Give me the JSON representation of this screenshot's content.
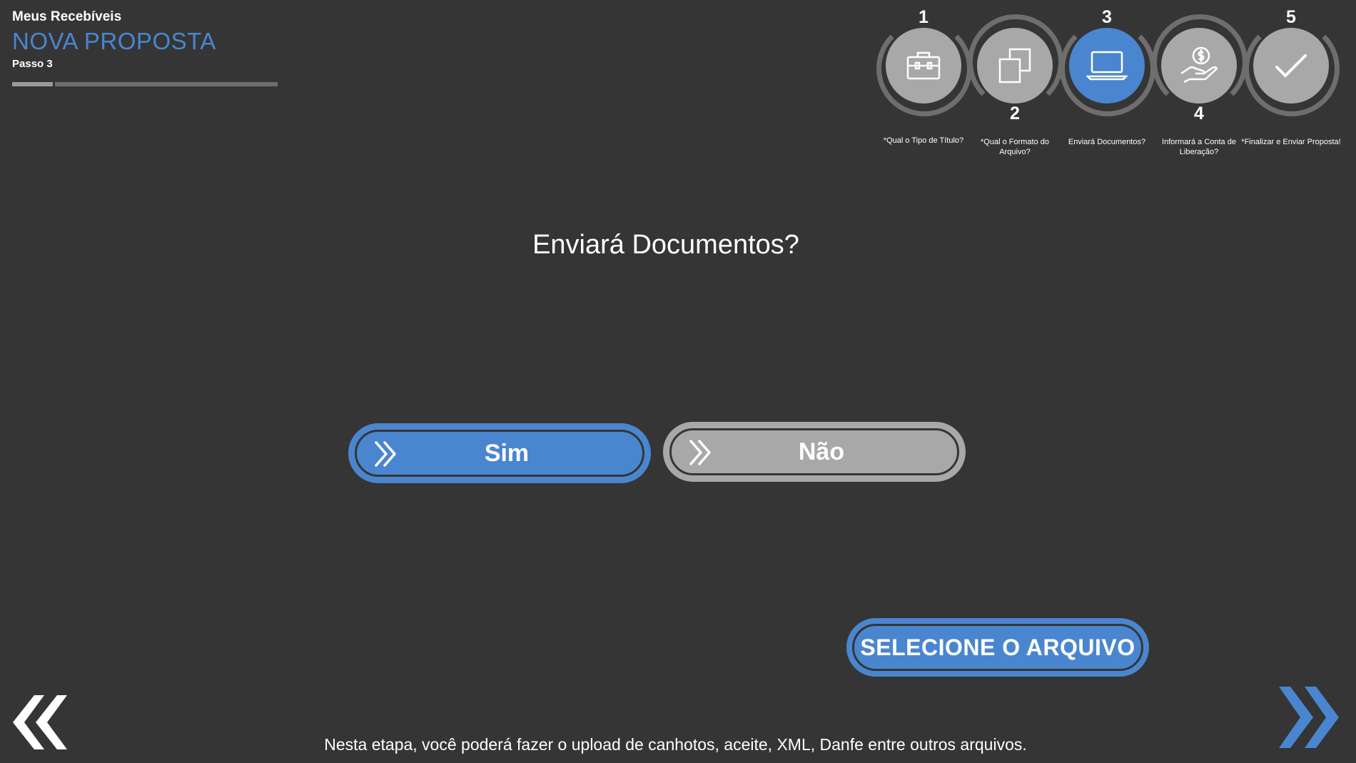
{
  "header": {
    "app_name": "Meus Recebíveis",
    "page_title": "NOVA PROPOSTA",
    "step_label": "Passo 3"
  },
  "stepper": {
    "current_step": 3,
    "steps": [
      {
        "number": "1",
        "caption": "*Qual o Tipo de Título?",
        "icon": "briefcase-icon"
      },
      {
        "number": "2",
        "caption": "*Qual o Formato do Arquivo?",
        "icon": "copy-icon"
      },
      {
        "number": "3",
        "caption": "Enviará Documentos?",
        "icon": "laptop-icon"
      },
      {
        "number": "4",
        "caption": "Informará a Conta de Liberação?",
        "icon": "hand-money-icon"
      },
      {
        "number": "5",
        "caption": "*Finalizar e Enviar Proposta!",
        "icon": "checkmark-icon"
      }
    ]
  },
  "main": {
    "question": "Enviará Documentos?",
    "yes_label": "Sim",
    "no_label": "Não",
    "select_file_label": "SELECIONE O ARQUIVO"
  },
  "footer": {
    "note": "Nesta etapa, você poderá fazer o upload de canhotos, aceite, XML, Danfe entre outros arquivos."
  },
  "colors": {
    "background": "#353535",
    "accent": "#4a86cf",
    "inactive": "#a8a8a8",
    "ring": "#6e6e6e"
  },
  "icons": {
    "back": "double-chevron-left-icon",
    "next": "double-chevron-right-icon",
    "choice": "double-chevron-right-icon"
  }
}
